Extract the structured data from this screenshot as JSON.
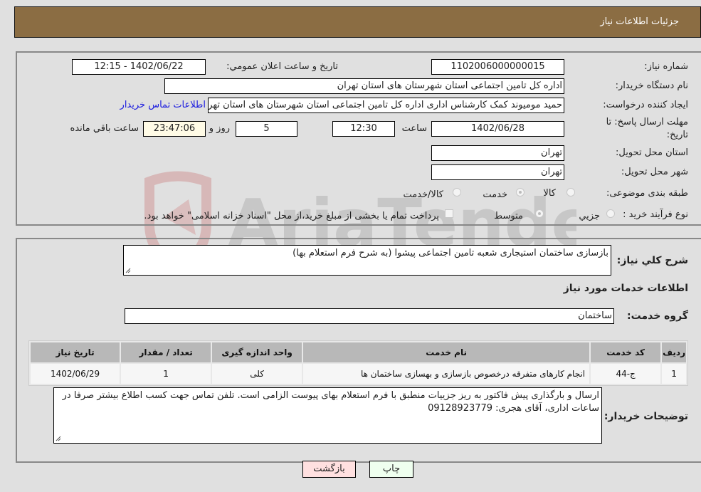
{
  "header": {
    "title": "جزئيات اطلاعات نیاز"
  },
  "form": {
    "need_number": {
      "label": "شماره نیاز:",
      "value": "1102006000000015"
    },
    "announce_datetime": {
      "label": "تاريخ و ساعت اعلان عمومي:",
      "value": "1402/06/22 - 12:15"
    },
    "buyer_org": {
      "label": "نام دستگاه خريدار:",
      "value": "اداره کل تامین اجتماعی استان شهرستان های استان تهران"
    },
    "requester": {
      "label": "ايجاد کننده درخواست:",
      "value": "حمید مومیوند کمک کارشناس اداری اداره کل تامین اجتماعی استان شهرستان های استان تهران",
      "contact_link": "اطلاعات تماس خريدار"
    },
    "deadline": {
      "label_line1": "مهلت ارسال پاسخ: تا",
      "label_line2": "تاريخ:",
      "date": "1402/06/28",
      "time_label": "ساعت",
      "time": "12:30",
      "days": "5",
      "days_label": "روز و",
      "remaining": "23:47:06",
      "remaining_label": "ساعت باقي مانده"
    },
    "province": {
      "label": "استان محل تحويل:",
      "value": "تهران"
    },
    "city": {
      "label": "شهر محل تحويل:",
      "value": "تهران"
    },
    "category": {
      "label": "طبقه بندی موضوعی:",
      "options": [
        {
          "label": "کالا",
          "selected": false
        },
        {
          "label": "خدمت",
          "selected": true
        },
        {
          "label": "کالا/خدمت",
          "selected": false
        }
      ]
    },
    "purchase_type": {
      "label": "نوع فرآيند خريد :",
      "options": [
        {
          "label": "جزيي",
          "selected": false
        },
        {
          "label": "متوسط",
          "selected": true
        }
      ],
      "treasury_note": "پرداخت تمام یا بخشی از مبلغ خرید،از محل \"اسناد خزانه اسلامی\" خواهد بود."
    }
  },
  "details": {
    "summary_label": "شرح كلي نياز:",
    "summary": "بازسازی ساختمان استیجاری شعبه تامین اجتماعی پیشوا (به شرح فرم استعلام بها)",
    "services_heading": "اطلاعات خدمات مورد نياز",
    "service_group_label": "گروه خدمت:",
    "service_group": "ساختمان",
    "table": {
      "headers": [
        "رديف",
        "کد خدمت",
        "نام خدمت",
        "واحد اندازه گيری",
        "تعداد / مقدار",
        "تاريخ نياز"
      ],
      "rows": [
        [
          "1",
          "ج-44",
          "انجام کارهای متفرقه درخصوص بازسازی و بهسازی ساختمان ها",
          "کلی",
          "1",
          "1402/06/29"
        ]
      ]
    },
    "buyer_notes_label": "توضيحات خريدار:",
    "buyer_notes": "ارسال و بارگذاری پیش فاکتور به ریز جزییات منطبق با فرم استعلام بهای پیوست الزامی است. تلفن تماس جهت کسب اطلاع بیشتر صرفا در ساعات اداری، آقای هجری: 09128923779"
  },
  "buttons": {
    "print": "چاپ",
    "back": "بازگشت"
  },
  "watermark": {
    "text": "AriaTender.neT"
  },
  "colors": {
    "header": "#8b6d43",
    "link": "#1a1adf",
    "print_bg": "#efffef",
    "back_bg": "#ffe0e0",
    "remaining_bg": "#fffbe6"
  }
}
